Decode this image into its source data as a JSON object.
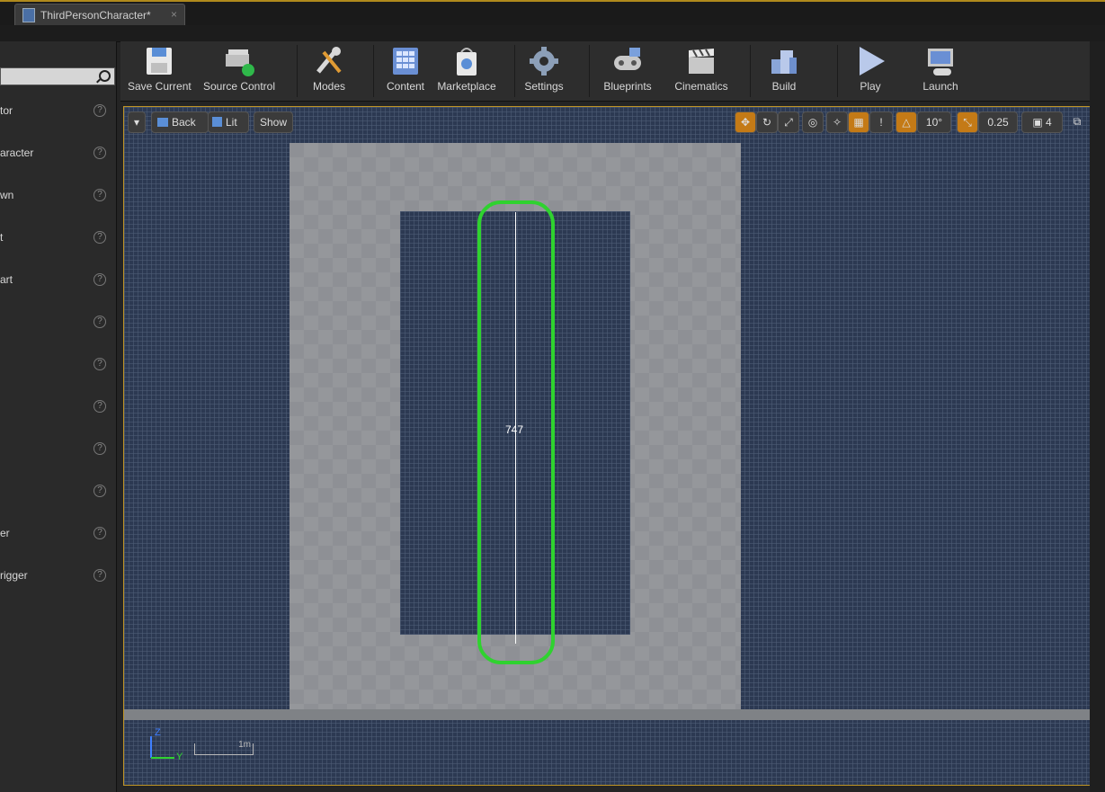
{
  "tab": {
    "title": "ThirdPersonCharacter*",
    "close": "×"
  },
  "left_panel": {
    "items": [
      {
        "label": "tor"
      },
      {
        "label": "aracter"
      },
      {
        "label": "wn"
      },
      {
        "label": "t"
      },
      {
        "label": "art"
      },
      {
        "label": ""
      },
      {
        "label": ""
      },
      {
        "label": ""
      },
      {
        "label": ""
      },
      {
        "label": ""
      },
      {
        "label": "er"
      },
      {
        "label": "rigger"
      }
    ],
    "help_glyph": "?"
  },
  "toolbar": {
    "save_current": "Save Current",
    "source_control": "Source Control",
    "modes": "Modes",
    "content": "Content",
    "marketplace": "Marketplace",
    "settings": "Settings",
    "blueprints": "Blueprints",
    "cinematics": "Cinematics",
    "build": "Build",
    "play": "Play",
    "launch": "Launch"
  },
  "viewport": {
    "back": "Back",
    "lit": "Lit",
    "show": "Show",
    "rotation_snap": "10°",
    "scale_snap": "0.25",
    "camera_speed": "4",
    "measure_value": "747",
    "scale_label": "1m",
    "axis_z": "Z",
    "axis_y": "Y"
  },
  "colors": {
    "accent": "#c09526",
    "capsule": "#2fd22f",
    "viewport_bg": "#2c3952"
  }
}
